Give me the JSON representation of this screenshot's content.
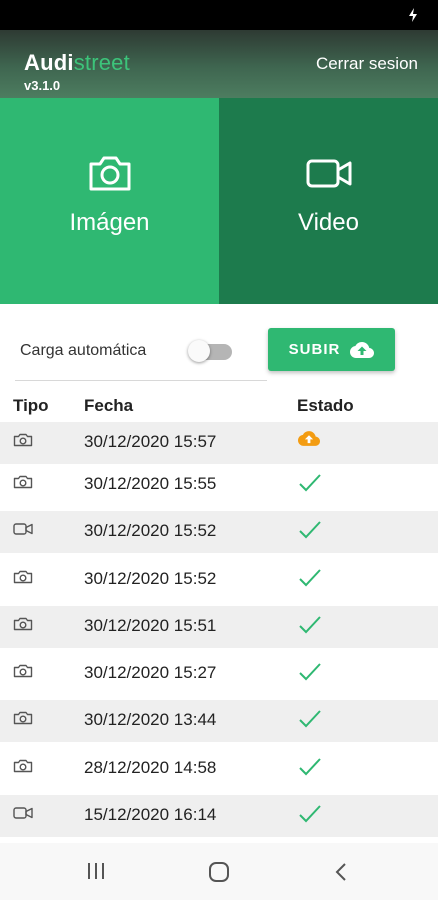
{
  "header": {
    "brand_part1": "Audi",
    "brand_part2": "street",
    "version": "v3.1.0",
    "logout_label": "Cerrar sesion"
  },
  "tiles": {
    "image_label": "Imágen",
    "video_label": "Video"
  },
  "controls": {
    "auto_upload_label": "Carga automática",
    "auto_upload_on": false,
    "upload_button_label": "SUBIR"
  },
  "table": {
    "headers": {
      "tipo": "Tipo",
      "fecha": "Fecha",
      "estado": "Estado"
    },
    "rows": [
      {
        "type": "camera-icon",
        "date": "30/12/2020 15:57",
        "status": "upload-pending-icon"
      },
      {
        "type": "camera-icon",
        "date": "30/12/2020 15:55",
        "status": "check-icon"
      },
      {
        "type": "video-icon",
        "date": "30/12/2020 15:52",
        "status": "check-icon"
      },
      {
        "type": "camera-icon",
        "date": "30/12/2020 15:52",
        "status": "check-icon"
      },
      {
        "type": "camera-icon",
        "date": "30/12/2020 15:51",
        "status": "check-icon"
      },
      {
        "type": "camera-icon",
        "date": "30/12/2020 15:27",
        "status": "check-icon"
      },
      {
        "type": "camera-icon",
        "date": "30/12/2020 13:44",
        "status": "check-icon"
      },
      {
        "type": "camera-icon",
        "date": "28/12/2020 14:58",
        "status": "check-icon"
      },
      {
        "type": "video-icon",
        "date": "15/12/2020 16:14",
        "status": "check-icon"
      }
    ]
  },
  "colors": {
    "accent": "#2fb872",
    "accent_dark": "#1d7b4d",
    "pending": "#f39c12",
    "check": "#2fb872"
  }
}
